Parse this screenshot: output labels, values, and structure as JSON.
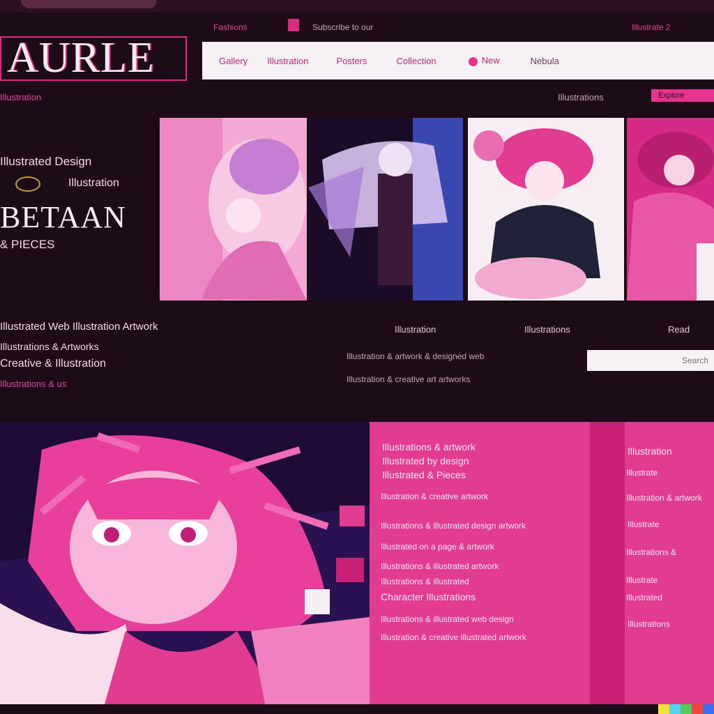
{
  "brand": {
    "title": "AURLE",
    "sub": "Illustration"
  },
  "utility": {
    "left": "Fashions",
    "center": "Subscribe to our",
    "right": "Illustrate 2"
  },
  "nav": {
    "items": [
      "Gallery",
      "Illustration",
      "Posters",
      "Collection",
      "New",
      "Nebula"
    ]
  },
  "subnav": {
    "text": "Illustrations",
    "button": "Explore"
  },
  "hero": {
    "line1": "Illustrated Design",
    "line2": "Illustration",
    "headline": "BETAAN",
    "line4": "& PIECES"
  },
  "meta": {
    "heading": "Illustrated Web Illustration Artwork",
    "line1": "Illustrations & Artworks",
    "line2": "Creative & Illustration",
    "link": "Illustrations & us",
    "col1": "Illustration",
    "col2": "Illustrations",
    "col3": "Read",
    "desc1": "Illustration & artwork & designed web",
    "desc2": "Illustration & creative art artworks",
    "search_placeholder": "Search"
  },
  "panelA": {
    "t1": "Illustrations & artwork",
    "t2": "Illustrated by design",
    "t3": "Illustrated & Pieces",
    "b1": "Illustration & creative artwork",
    "b2": "Illustrations & illustrated design artwork",
    "b3": "Illustrated on a page & artwork",
    "b4": "Illustrations & illustrated artwork",
    "b5": "Illustrations & illustrated",
    "t4": "Character Illustrations",
    "b6": "Illustrations & illustrated web design",
    "b7": "Illustration & creative illustrated artwork"
  },
  "panelC": {
    "t1": "Illustration",
    "b1": "Illustrate",
    "b2": "Illustration & artwork",
    "b3": "Illustrate",
    "b4": "Illustrations &",
    "b5": "Illustrate",
    "b6": "Illustrated",
    "b7": "Illustrations"
  },
  "colors": {
    "accent": "#e23b92",
    "background": "#1d0b17",
    "strip": [
      "#f7e03c",
      "#55d3ee",
      "#58c95a",
      "#f0463c",
      "#3c6ef0"
    ]
  }
}
